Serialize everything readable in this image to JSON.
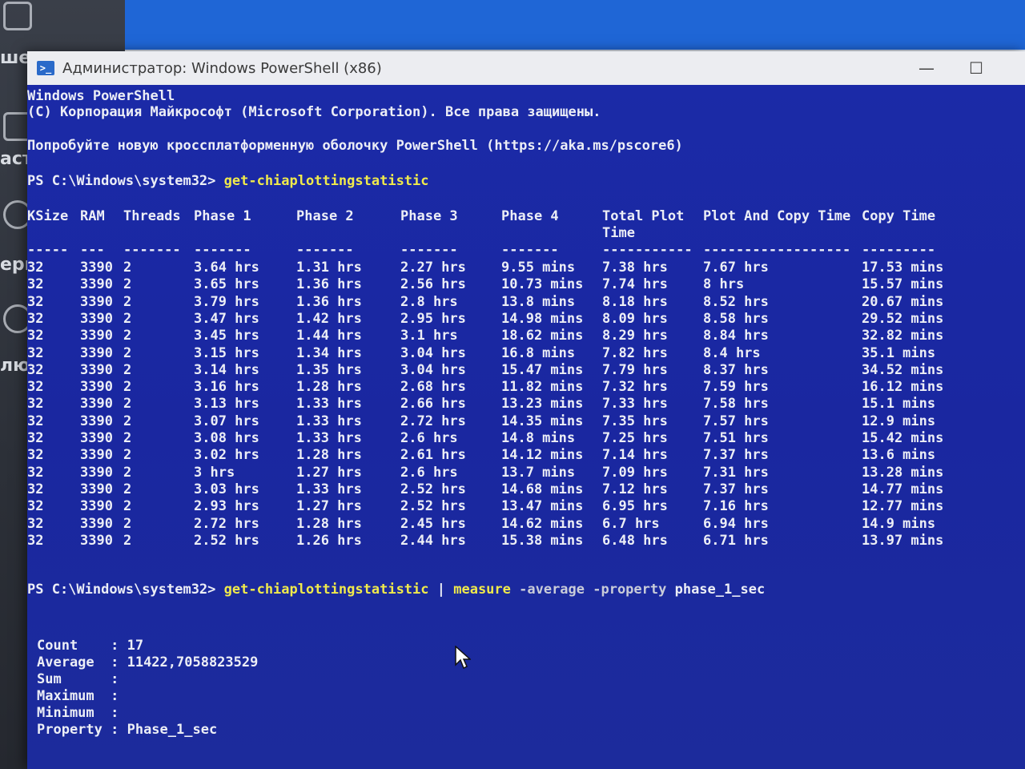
{
  "desktop": {
    "labels": [
      "шел",
      "аст",
      "ерн",
      "лю"
    ]
  },
  "window": {
    "title": "Администратор: Windows PowerShell (x86)",
    "minimize": "—",
    "maximize": "☐"
  },
  "console": {
    "header1": "Windows PowerShell",
    "header2": "(C) Корпорация Майкрософт (Microsoft Corporation). Все права защищены.",
    "header3": "Попробуйте новую кроссплатформенную оболочку PowerShell (https://aka.ms/pscore6)",
    "prompt1": "PS C:\\Windows\\system32> ",
    "command1": "get-chiaplottingstatistic",
    "table": {
      "headers": [
        "KSize",
        "RAM",
        "Threads",
        "Phase 1",
        "Phase 2",
        "Phase 3",
        "Phase 4",
        "Total Plot",
        "Plot And Copy Time",
        "Copy Time"
      ],
      "header_line2": "Time",
      "separators": [
        "-----",
        "---",
        "-------",
        "-------",
        "-------",
        "-------",
        "-------",
        "-----------",
        "------------------",
        "---------"
      ],
      "rows": [
        [
          "32",
          "3390",
          "2",
          "3.64 hrs",
          "1.31 hrs",
          "2.27 hrs",
          "9.55 mins",
          "7.38 hrs",
          "7.67 hrs",
          "17.53 mins"
        ],
        [
          "32",
          "3390",
          "2",
          "3.65 hrs",
          "1.36 hrs",
          "2.56 hrs",
          "10.73 mins",
          "7.74 hrs",
          "8 hrs",
          "15.57 mins"
        ],
        [
          "32",
          "3390",
          "2",
          "3.79 hrs",
          "1.36 hrs",
          "2.8 hrs",
          "13.8 mins",
          "8.18 hrs",
          "8.52 hrs",
          "20.67 mins"
        ],
        [
          "32",
          "3390",
          "2",
          "3.47 hrs",
          "1.42 hrs",
          "2.95 hrs",
          "14.98 mins",
          "8.09 hrs",
          "8.58 hrs",
          "29.52 mins"
        ],
        [
          "32",
          "3390",
          "2",
          "3.45 hrs",
          "1.44 hrs",
          "3.1 hrs",
          "18.62 mins",
          "8.29 hrs",
          "8.84 hrs",
          "32.82 mins"
        ],
        [
          "32",
          "3390",
          "2",
          "3.15 hrs",
          "1.34 hrs",
          "3.04 hrs",
          "16.8 mins",
          "7.82 hrs",
          "8.4 hrs",
          "35.1 mins"
        ],
        [
          "32",
          "3390",
          "2",
          "3.14 hrs",
          "1.35 hrs",
          "3.04 hrs",
          "15.47 mins",
          "7.79 hrs",
          "8.37 hrs",
          "34.52 mins"
        ],
        [
          "32",
          "3390",
          "2",
          "3.16 hrs",
          "1.28 hrs",
          "2.68 hrs",
          "11.82 mins",
          "7.32 hrs",
          "7.59 hrs",
          "16.12 mins"
        ],
        [
          "32",
          "3390",
          "2",
          "3.13 hrs",
          "1.33 hrs",
          "2.66 hrs",
          "13.23 mins",
          "7.33 hrs",
          "7.58 hrs",
          "15.1 mins"
        ],
        [
          "32",
          "3390",
          "2",
          "3.07 hrs",
          "1.33 hrs",
          "2.72 hrs",
          "14.35 mins",
          "7.35 hrs",
          "7.57 hrs",
          "12.9 mins"
        ],
        [
          "32",
          "3390",
          "2",
          "3.08 hrs",
          "1.33 hrs",
          "2.6 hrs",
          "14.8 mins",
          "7.25 hrs",
          "7.51 hrs",
          "15.42 mins"
        ],
        [
          "32",
          "3390",
          "2",
          "3.02 hrs",
          "1.28 hrs",
          "2.61 hrs",
          "14.12 mins",
          "7.14 hrs",
          "7.37 hrs",
          "13.6 mins"
        ],
        [
          "32",
          "3390",
          "2",
          "3 hrs",
          "1.27 hrs",
          "2.6 hrs",
          "13.7 mins",
          "7.09 hrs",
          "7.31 hrs",
          "13.28 mins"
        ],
        [
          "32",
          "3390",
          "2",
          "3.03 hrs",
          "1.33 hrs",
          "2.52 hrs",
          "14.68 mins",
          "7.12 hrs",
          "7.37 hrs",
          "14.77 mins"
        ],
        [
          "32",
          "3390",
          "2",
          "2.93 hrs",
          "1.27 hrs",
          "2.52 hrs",
          "13.47 mins",
          "6.95 hrs",
          "7.16 hrs",
          "12.77 mins"
        ],
        [
          "32",
          "3390",
          "2",
          "2.72 hrs",
          "1.28 hrs",
          "2.45 hrs",
          "14.62 mins",
          "6.7 hrs",
          "6.94 hrs",
          "14.9 mins"
        ],
        [
          "32",
          "3390",
          "2",
          "2.52 hrs",
          "1.26 hrs",
          "2.44 hrs",
          "15.38 mins",
          "6.48 hrs",
          "6.71 hrs",
          "13.97 mins"
        ]
      ]
    },
    "prompt2": "PS C:\\Windows\\system32> ",
    "command2_a": "get-chiaplottingstatistic",
    "command2_pipe": " | ",
    "command2_b": "measure",
    "command2_c": " -average -property ",
    "command2_d": "phase_1_sec",
    "measure": [
      {
        "label": "Count   ",
        "value": "17"
      },
      {
        "label": "Average ",
        "value": "11422,7058823529"
      },
      {
        "label": "Sum     ",
        "value": ""
      },
      {
        "label": "Maximum ",
        "value": ""
      },
      {
        "label": "Minimum ",
        "value": ""
      },
      {
        "label": "Property",
        "value": "Phase_1_sec"
      }
    ]
  }
}
